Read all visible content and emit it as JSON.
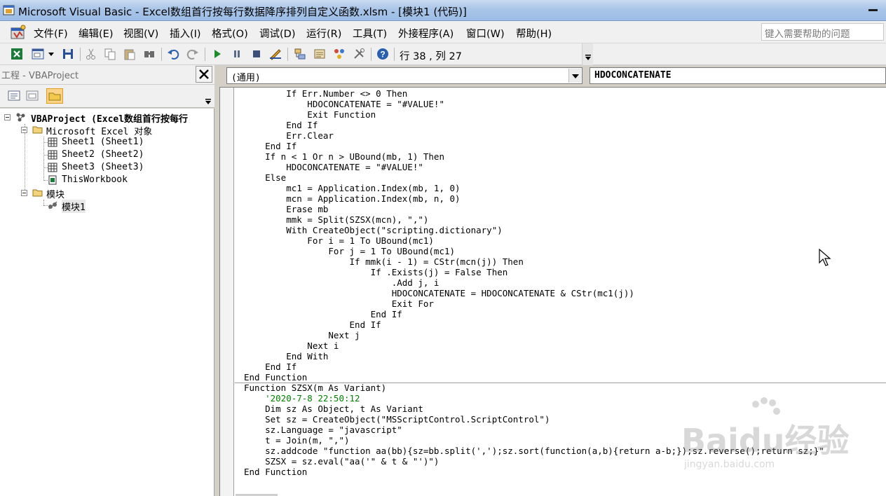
{
  "window": {
    "title": "Microsoft Visual Basic - Excel数组首行按每行数据降序排列自定义函数.xlsm - [模块1 (代码)]"
  },
  "menu": {
    "items": [
      "文件(F)",
      "编辑(E)",
      "视图(V)",
      "插入(I)",
      "格式(O)",
      "调试(D)",
      "运行(R)",
      "工具(T)",
      "外接程序(A)",
      "窗口(W)",
      "帮助(H)"
    ],
    "help_placeholder": "键入需要帮助的问题"
  },
  "toolbar": {
    "cursor_position": "行 38 , 列 27",
    "icons": [
      "excel-icon",
      "insert-userform-icon",
      "dropdown-arrow-icon",
      "save-icon",
      "cut-icon",
      "copy-icon",
      "paste-icon",
      "find-icon",
      "undo-icon",
      "redo-icon",
      "run-icon",
      "break-icon",
      "reset-icon",
      "design-mode-icon",
      "project-explorer-icon",
      "properties-icon",
      "object-browser-icon",
      "toolbox-icon",
      "help-icon"
    ]
  },
  "project_panel": {
    "title": "工程 - VBAProject",
    "tree": [
      {
        "label": "VBAProject (Excel数组首行按每行",
        "level": 0
      },
      {
        "label": "Microsoft Excel 对象",
        "level": 1
      },
      {
        "label": "Sheet1 (Sheet1)",
        "level": 2
      },
      {
        "label": "Sheet2 (Sheet2)",
        "level": 2
      },
      {
        "label": "Sheet3 (Sheet3)",
        "level": 2
      },
      {
        "label": "ThisWorkbook",
        "level": 2
      },
      {
        "label": "模块",
        "level": 1
      },
      {
        "label": "模块1",
        "level": 2
      }
    ]
  },
  "code_window": {
    "object_combo": "(通用)",
    "procedure_combo": "HDOCONCATENATE",
    "lines": [
      "        If Err.Number <> 0 Then",
      "            HDOCONCATENATE = \"#VALUE!\"",
      "            Exit Function",
      "        End If",
      "        Err.Clear",
      "    End If",
      "    If n < 1 Or n > UBound(mb, 1) Then",
      "        HDOCONCATENATE = \"#VALUE!\"",
      "    Else",
      "        mc1 = Application.Index(mb, 1, 0)",
      "        mcn = Application.Index(mb, n, 0)",
      "        Erase mb",
      "        mmk = Split(SZSX(mcn), \",\")",
      "        With CreateObject(\"scripting.dictionary\")",
      "            For i = 1 To UBound(mc1)",
      "                For j = 1 To UBound(mc1)",
      "                    If mmk(i - 1) = CStr(mcn(j)) Then",
      "                        If .Exists(j) = False Then",
      "                            .Add j, i",
      "                            HDOCONCATENATE = HDOCONCATENATE & CStr(mc1(j))",
      "                            Exit For",
      "                        End If",
      "                    End If",
      "                Next j",
      "            Next i",
      "        End With",
      "    End If",
      "End Function",
      "Function SZSX(m As Variant)",
      "    '2020-7-8 22:50:12",
      "    Dim sz As Object, t As Variant",
      "    Set sz = CreateObject(\"MSScriptControl.ScriptControl\")",
      "    sz.Language = \"javascript\"",
      "    t = Join(m, \",\")",
      "    sz.addcode \"function aa(bb){sz=bb.split(',');sz.sort(function(a,b){return a-b;});sz.reverse();return sz;}\"",
      "    SZSX = sz.eval(\"aa('\" & t & \"')\")",
      "End Function"
    ],
    "comment_line_index": 29,
    "separator_after_line_index": 27
  },
  "watermark": {
    "text": "Baidu经验",
    "url": "jingyan.baidu.com"
  },
  "colors": {
    "comment": "#008000",
    "titlebar": "#a9c5e8",
    "active_tool": "#fbd48a"
  }
}
